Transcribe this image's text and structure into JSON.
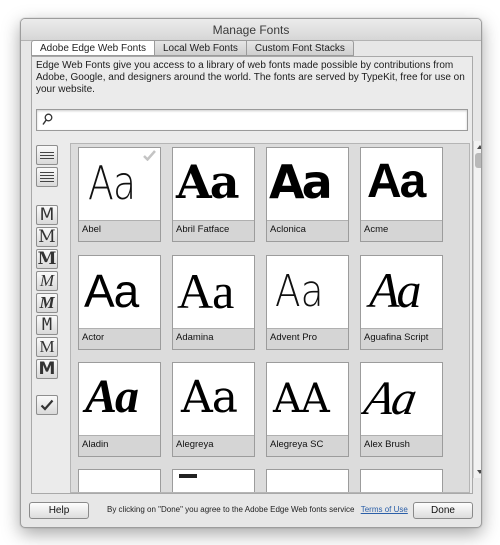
{
  "window": {
    "title": "Manage Fonts"
  },
  "tabs": [
    {
      "label": "Adobe Edge Web Fonts",
      "active": true
    },
    {
      "label": "Local Web Fonts",
      "active": false
    },
    {
      "label": "Custom Font Stacks",
      "active": false
    }
  ],
  "description": "Edge Web Fonts give you access to a library of web fonts made possible by contributions from Adobe, Google, and designers around the world. The fonts are served by TypeKit, free for use on your website.",
  "search": {
    "value": "",
    "placeholder": "",
    "icon": "search-icon"
  },
  "filters": {
    "list_icons": [
      "list-view-icon",
      "grid-view-icon"
    ],
    "classification_glyphs": [
      "M",
      "M",
      "M",
      "M",
      "M",
      "M",
      "M",
      "M"
    ],
    "classification_icons": [
      "sans-serif-icon",
      "serif-icon",
      "slab-serif-icon",
      "script-icon",
      "blackletter-icon",
      "monospaced-icon",
      "handwritten-icon",
      "decorative-icon"
    ],
    "selected_icon": "checkmark-icon"
  },
  "fonts": [
    {
      "name": "Abel",
      "sample": "Aa",
      "checked": true
    },
    {
      "name": "Abril Fatface",
      "sample": "Aa"
    },
    {
      "name": "Aclonica",
      "sample": "Aa"
    },
    {
      "name": "Acme",
      "sample": "Aa"
    },
    {
      "name": "Actor",
      "sample": "Aa"
    },
    {
      "name": "Adamina",
      "sample": "Aa"
    },
    {
      "name": "Advent Pro",
      "sample": "Aa"
    },
    {
      "name": "Aguafina Script",
      "sample": "Aa"
    },
    {
      "name": "Aladin",
      "sample": "Aa"
    },
    {
      "name": "Alegreya",
      "sample": "Aa"
    },
    {
      "name": "Alegreya SC",
      "sample": "AA"
    },
    {
      "name": "Alex Brush",
      "sample": "Aa"
    }
  ],
  "footer": {
    "help_label": "Help",
    "notice": "By clicking on \"Done\" you agree to the Adobe Edge Web fonts service",
    "terms_link": "Terms of Use",
    "done_label": "Done"
  },
  "colors": {
    "link": "#2b5fa8",
    "window_bg": "#e7e7e7"
  }
}
